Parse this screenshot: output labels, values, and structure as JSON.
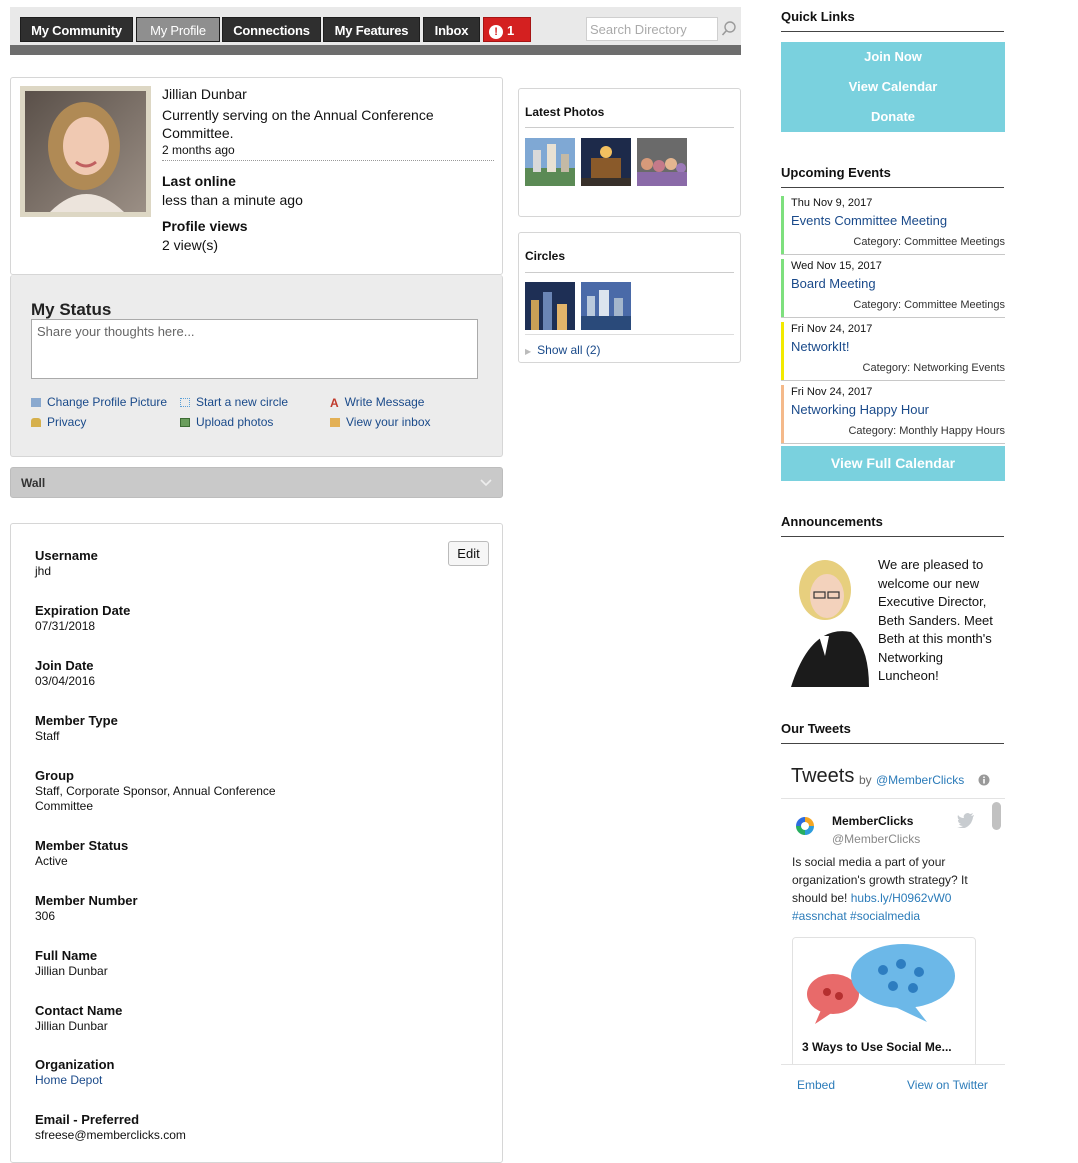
{
  "nav": {
    "tabs": [
      {
        "label": "My Community"
      },
      {
        "label": "My Profile"
      },
      {
        "label": "Connections"
      },
      {
        "label": "My Features"
      },
      {
        "label": "Inbox"
      },
      {
        "label": "1"
      }
    ],
    "search_placeholder": "Search Directory"
  },
  "profile": {
    "name": "Jillian Dunbar",
    "status_line1": "Currently serving on the Annual Conference",
    "status_line2": "Committee.",
    "status_time": "2 months ago",
    "last_online_label": "Last online",
    "last_online_value": "less than a minute ago",
    "views_label": "Profile views",
    "views_value": "2 view(s)"
  },
  "status": {
    "heading": "My Status",
    "placeholder": "Share your thoughts here...",
    "actions": [
      {
        "label": "Change Profile Picture"
      },
      {
        "label": "Start a new circle"
      },
      {
        "label": "Write Message"
      },
      {
        "label": "Privacy"
      },
      {
        "label": "Upload photos"
      },
      {
        "label": "View your inbox"
      }
    ]
  },
  "wall": {
    "label": "Wall"
  },
  "photos": {
    "heading": "Latest Photos"
  },
  "circles": {
    "heading": "Circles",
    "show_all": "Show all (2)"
  },
  "details": {
    "edit_label": "Edit",
    "fields": [
      {
        "label": "Username",
        "value": "jhd"
      },
      {
        "label": "Expiration Date",
        "value": "07/31/2018"
      },
      {
        "label": "Join Date",
        "value": "03/04/2016"
      },
      {
        "label": "Member Type",
        "value": "Staff"
      },
      {
        "label": "Group",
        "value": "Staff, Corporate Sponsor, Annual Conference",
        "value2": "Committee"
      },
      {
        "label": "Member Status",
        "value": "Active"
      },
      {
        "label": "Member Number",
        "value": "306"
      },
      {
        "label": "Full Name",
        "value": "Jillian Dunbar"
      },
      {
        "label": "Contact Name",
        "value": "Jillian Dunbar"
      },
      {
        "label": "Organization",
        "value": "Home Depot"
      },
      {
        "label": "Email - Preferred",
        "value": "sfreese@memberclicks.com"
      }
    ]
  },
  "sidebar": {
    "quick_links_heading": "Quick Links",
    "quick_links": [
      {
        "label": "Join Now"
      },
      {
        "label": "View Calendar"
      },
      {
        "label": "Donate"
      }
    ],
    "events_heading": "Upcoming Events",
    "events": [
      {
        "date": "Thu Nov 9, 2017",
        "title": "Events Committee Meeting",
        "category": "Category: Committee Meetings",
        "color": "#7ee07e"
      },
      {
        "date": "Wed Nov 15, 2017",
        "title": "Board Meeting",
        "category": "Category: Committee Meetings",
        "color": "#7ee07e"
      },
      {
        "date": "Fri Nov 24, 2017",
        "title": "NetworkIt!",
        "category": "Category: Networking Events",
        "color": "#f2ea00"
      },
      {
        "date": "Fri Nov 24, 2017",
        "title": "Networking Happy Hour",
        "category": "Category: Monthly Happy Hours",
        "color": "#f4b98a"
      }
    ],
    "full_calendar": "View Full Calendar",
    "announcements_heading": "Announcements",
    "announcement": [
      "We are pleased to",
      "welcome our new",
      "Executive Director,",
      "Beth Sanders. Meet",
      "Beth at this month's",
      "Networking",
      "Luncheon!"
    ],
    "tweets_heading": "Our Tweets",
    "tweets": {
      "title": "Tweets",
      "by": "by",
      "handle_link": "@MemberClicks",
      "account_name": "MemberClicks",
      "account_handle": "@MemberClicks",
      "text1": "Is social media a part of your",
      "text2": "organization's growth strategy? It",
      "text3": "should be!",
      "link1": "hubs.ly/H0962vW0",
      "link2": "#assnchat #socialmedia",
      "card_title": "3 Ways to Use Social Me...",
      "embed": "Embed",
      "view_on": "View on Twitter"
    }
  },
  "colors": {
    "accent_teal": "#7ad1de",
    "nav_dark": "#2f2f2f",
    "alert": "#d42020",
    "link": "#1a4a8a"
  }
}
